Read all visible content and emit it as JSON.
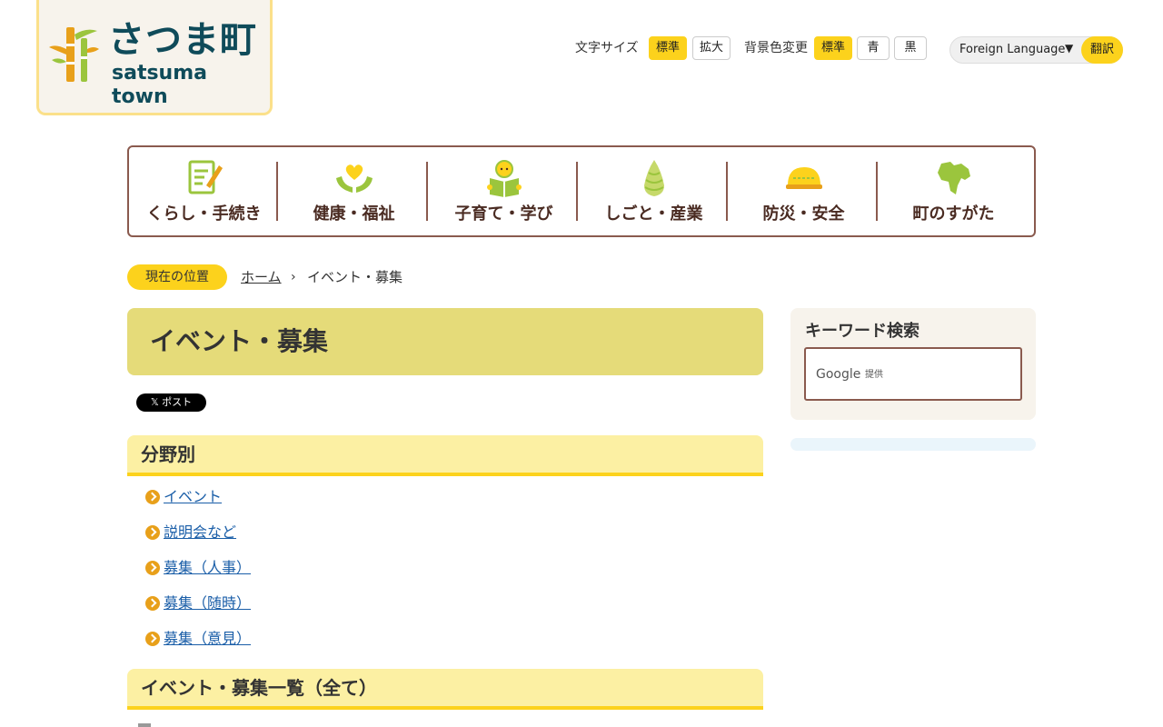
{
  "site": {
    "name": "さつま町",
    "name_roman": "satsuma town"
  },
  "utility": {
    "font_size_label": "文字サイズ",
    "font_size_options": [
      "標準",
      "拡大"
    ],
    "bg_color_label": "背景色変更",
    "bg_color_options": [
      "標準",
      "青",
      "黒"
    ],
    "language_select": "Foreign Language",
    "translate_button": "翻訳"
  },
  "nav": {
    "items": [
      {
        "label": "くらし・手続き",
        "icon": "form-pencil-icon"
      },
      {
        "label": "健康・福祉",
        "icon": "hands-heart-icon"
      },
      {
        "label": "子育て・学び",
        "icon": "child-reading-icon"
      },
      {
        "label": "しごと・産業",
        "icon": "bamboo-shoot-icon"
      },
      {
        "label": "防災・安全",
        "icon": "safety-helmet-icon"
      },
      {
        "label": "町のすがた",
        "icon": "town-map-icon"
      }
    ]
  },
  "breadcrumb": {
    "badge": "現在の位置",
    "home": "ホーム",
    "separator": "›",
    "current": "イベント・募集"
  },
  "main": {
    "title": "イベント・募集",
    "share_button": "𝕏 ポスト",
    "section_by_field": "分野別",
    "categories": [
      "イベント",
      "説明会など",
      "募集（人事）",
      "募集（随時）",
      "募集（意見）"
    ],
    "section_all": "イベント・募集一覧（全て）"
  },
  "sidebar": {
    "search_title": "キーワード検索",
    "search_provider": "Google",
    "search_provider_sub": "提供"
  },
  "colors": {
    "accent_yellow": "#fcd21c",
    "title_band": "#e5db79",
    "nav_border": "#8a5a4e",
    "section_band": "#fcf0a3",
    "logo_text": "#0f4b5a"
  }
}
